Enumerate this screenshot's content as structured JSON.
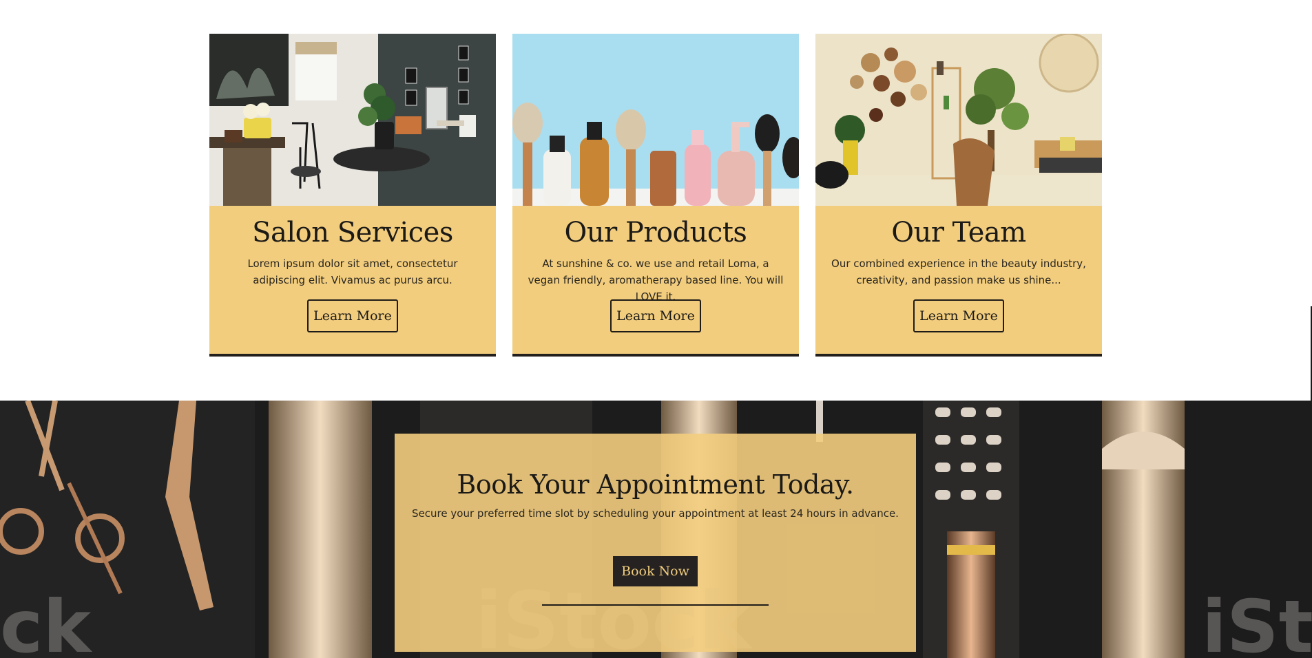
{
  "cards": [
    {
      "title": "Salon Services",
      "text": "Lorem ipsum dolor sit amet, consectetur adipiscing elit. Vivamus ac purus arcu.",
      "button": "Learn More",
      "image": "salon-interior-photo"
    },
    {
      "title": "Our Products",
      "text": "At sunshine & co. we use and retail Loma, a vegan friendly, aromatherapy based line. You will LOVE it.",
      "button": "Learn More",
      "image": "hair-products-photo"
    },
    {
      "title": "Our Team",
      "text": "Our combined experience in the beauty industry, creativity, and passion make us shine...",
      "button": "Learn More",
      "image": "team-lounge-photo"
    }
  ],
  "booking": {
    "title": "Book Your Appointment Today.",
    "subtitle": "Secure your preferred time slot by scheduling your appointment at least 24 hours in advance.",
    "button": "Book Now"
  },
  "banner": {
    "watermark_left": "ck",
    "watermark_center": "iStock",
    "watermark_right": "iSt"
  },
  "colors": {
    "card_bg": "#f2cd7e",
    "dark": "#252221",
    "accent_text": "#f2cd7e",
    "products_sky": "#a9def0"
  }
}
